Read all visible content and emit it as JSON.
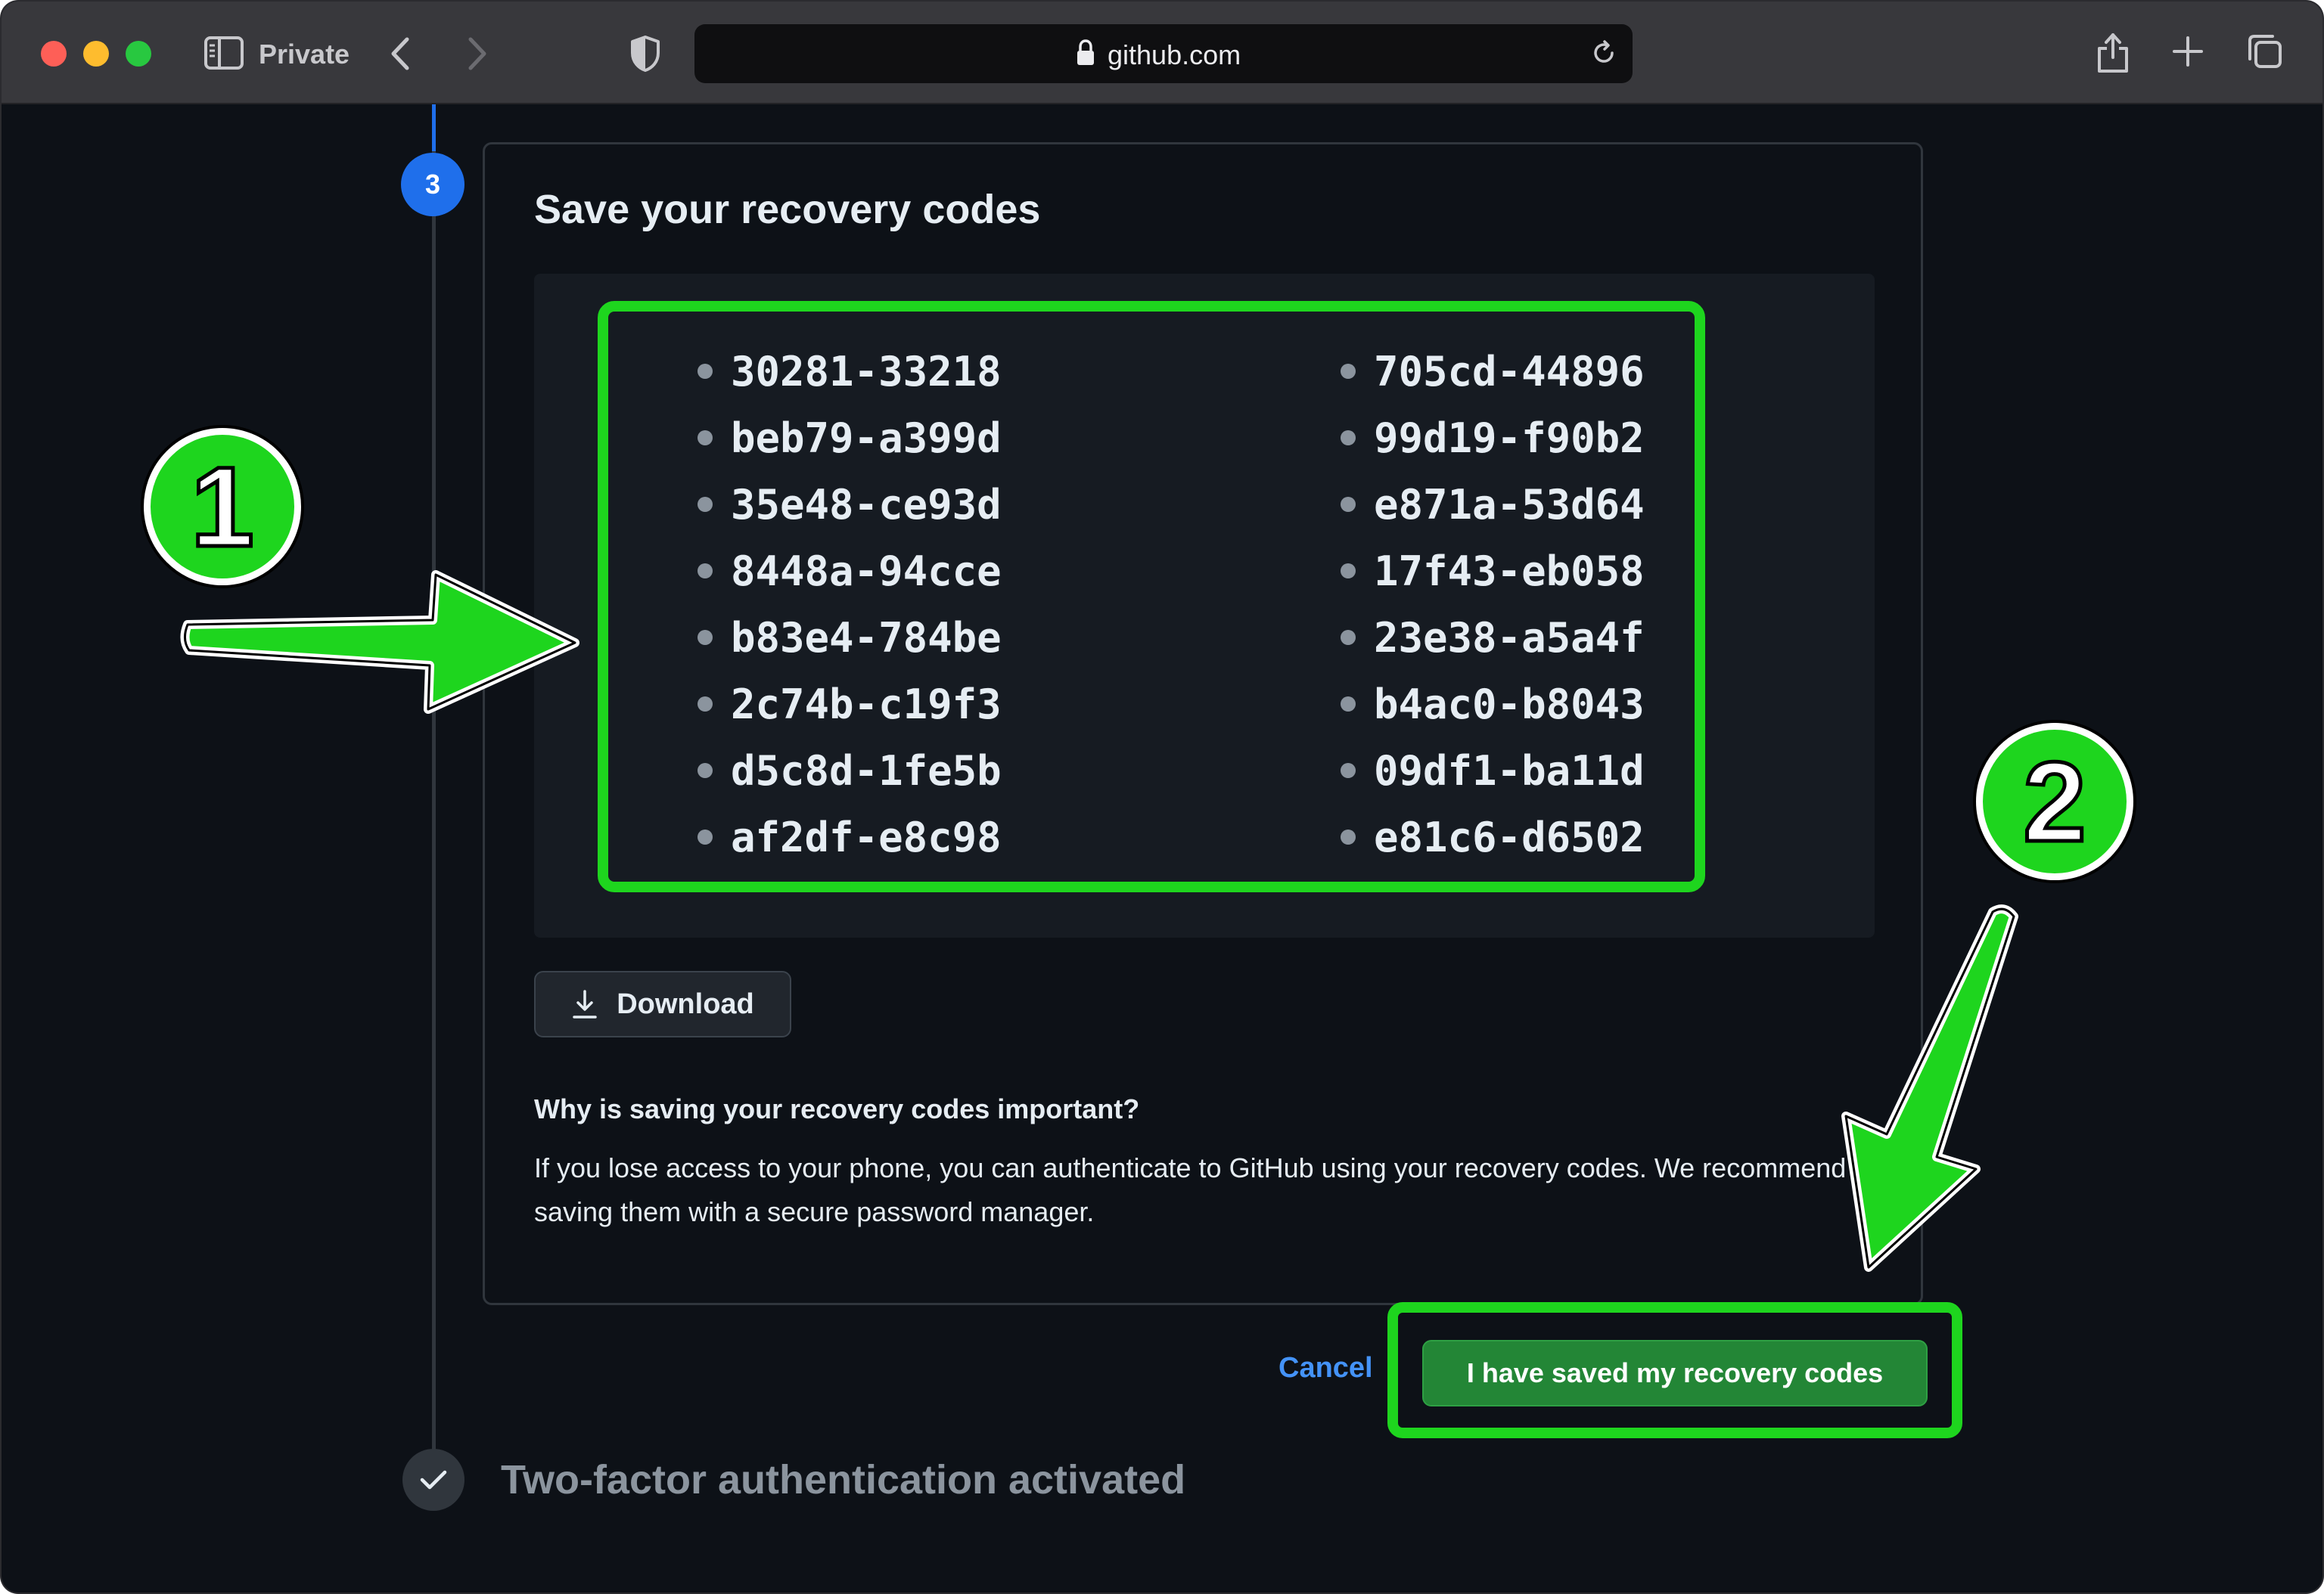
{
  "browser": {
    "mode_label": "Private",
    "url": "github.com"
  },
  "step": {
    "number": "3",
    "title": "Save your recovery codes"
  },
  "recovery_codes": {
    "left": [
      "30281-33218",
      "beb79-a399d",
      "35e48-ce93d",
      "8448a-94cce",
      "b83e4-784be",
      "2c74b-c19f3",
      "d5c8d-1fe5b",
      "af2df-e8c98"
    ],
    "right": [
      "705cd-44896",
      "99d19-f90b2",
      "e871a-53d64",
      "17f43-eb058",
      "23e38-a5a4f",
      "b4ac0-b8043",
      "09df1-ba11d",
      "e81c6-d6502"
    ]
  },
  "actions": {
    "download_label": "Download",
    "cancel_label": "Cancel",
    "confirm_label": "I have saved my recovery codes"
  },
  "info": {
    "heading": "Why is saving your recovery codes important?",
    "body": "If you lose access to your phone, you can authenticate to GitHub using your recovery codes. We recommend saving them with a secure password manager."
  },
  "next_step": {
    "label": "Two-factor authentication activated"
  },
  "annotations": {
    "badge_1": "1",
    "badge_2": "2",
    "color": "#1ed51e"
  },
  "colors": {
    "page_background": "#0d1117",
    "accent_blue": "#1f6feb",
    "link_blue": "#4493f8",
    "primary_green": "#238636"
  }
}
